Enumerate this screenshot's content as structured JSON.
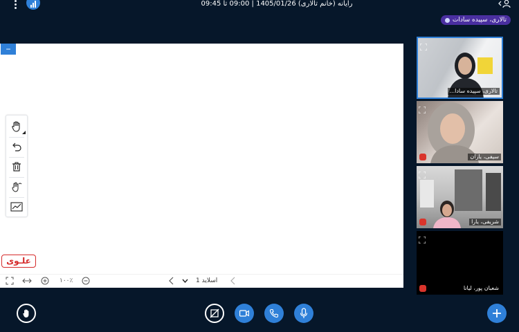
{
  "header": {
    "meeting_title": "رایانه (خانم تالاری) 1405/01/26 | 09:00 تا 09:45"
  },
  "presenter": {
    "label": "تالاری، سپیده سادات"
  },
  "whiteboard": {
    "minimize_label": "−",
    "logo_text": "علـوی",
    "tools": [
      "hand-tool",
      "undo",
      "delete",
      "multi-user",
      "chart"
    ],
    "navigation": {
      "slide_label": "اسلاید 1",
      "zoom_label": "۱۰۰٪"
    }
  },
  "participants": [
    {
      "name": "تالاری، سپیده سادا...",
      "muted": false,
      "has_video": true
    },
    {
      "name": "سیفی، یاران",
      "muted": true,
      "has_video": true
    },
    {
      "name": "شریفی، یارا",
      "muted": true,
      "has_video": true
    },
    {
      "name": "شعبان پور، لیانا",
      "muted": true,
      "has_video": false
    }
  ],
  "colors": {
    "background": "#06172a",
    "accent": "#2f80d8",
    "presenter_tag": "#4a2fa0",
    "mute": "#d9342b",
    "logo": "#d52a2a"
  },
  "controls": [
    "raise-hand",
    "screen-share-off",
    "camera",
    "phone",
    "microphone",
    "actions-plus"
  ]
}
